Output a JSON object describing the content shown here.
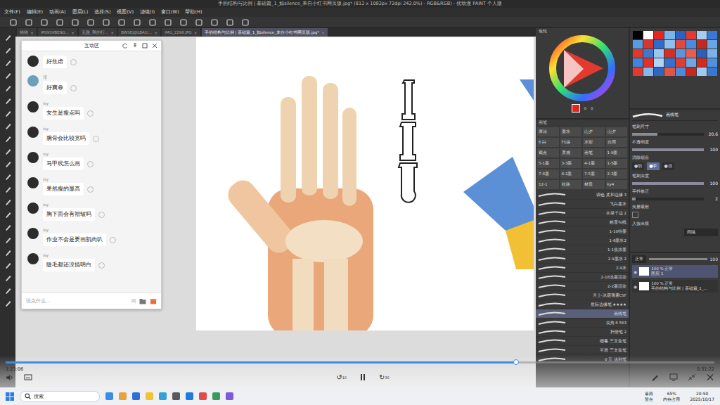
{
  "app": {
    "title": "手的结构与比例 | 基础篇_1_如silence_来自小红书网页版.jpg* (812 x 1082px 72dpi 242.0%) - RGB&RGB) - 优动漫 PAINT 个人版"
  },
  "menu": [
    "文件(F)",
    "编辑(E)",
    "动画(A)",
    "图层(L)",
    "选择(S)",
    "视图(V)",
    "滤镜(I)",
    "窗口(W)",
    "帮助(H)"
  ],
  "doc_tabs": [
    {
      "label": "猫猫",
      "selected": false
    },
    {
      "label": "IP09SVBENG...",
      "selected": false
    },
    {
      "label": "无题_我的行...",
      "selected": false
    },
    {
      "label": "BWSEJ@LBA1I...",
      "selected": false
    },
    {
      "label": "IMG_2298.JPG",
      "selected": false
    },
    {
      "label": "手的结构与比例 | 基础篇_1_如silence_来自小红书网页版.jpg*",
      "selected": true
    }
  ],
  "chat": {
    "title": "互动区",
    "messages": [
      {
        "name": "",
        "text": "好焦虑"
      },
      {
        "name": "淳",
        "text": "好爽😆"
      },
      {
        "name": "ivy",
        "text": "女生是瘦点吗"
      },
      {
        "name": "ivy",
        "text": "腕骨会比较宽吗"
      },
      {
        "name": "ivy",
        "text": "马甲线怎么画"
      },
      {
        "name": "ivy",
        "text": "果然瘦的显高"
      },
      {
        "name": "ivy",
        "text": "胸下面会有褶皱吗"
      },
      {
        "name": "ivy",
        "text": "作业不会是要画肌肉叭"
      },
      {
        "name": "ivy",
        "text": "睫毛都还没搞明白"
      }
    ],
    "input": {
      "placeholder": "说点什么...",
      "hint": "问"
    }
  },
  "color_panel": {
    "title": "色轮",
    "values": [
      "0",
      "0"
    ]
  },
  "swatches": [
    {
      "color": "#000000"
    },
    {
      "color": "#ffffff"
    },
    {
      "color": "#e3261e"
    },
    {
      "color": "#7ab4ea"
    },
    {
      "color": "#2a63c4"
    },
    {
      "color": "#e23a2f"
    },
    {
      "color": "#a7cdf2"
    },
    {
      "color": "#3a77d6"
    },
    {
      "color": "#5b9be0"
    },
    {
      "color": "#d8362c"
    },
    {
      "color": "#2f6cc9"
    },
    {
      "color": "#8fbfee"
    },
    {
      "color": "#e04a3c"
    },
    {
      "color": "#4a8ae0"
    },
    {
      "color": "#c02a22"
    },
    {
      "color": "#6aa6e6"
    },
    {
      "color": "#e4372b"
    },
    {
      "color": "#3c79d3"
    },
    {
      "color": "#9cc6f0"
    },
    {
      "color": "#d42e25"
    },
    {
      "color": "#5895de"
    },
    {
      "color": "#e85d50"
    },
    {
      "color": "#2b5fb8"
    },
    {
      "color": "#7eb1ea"
    },
    {
      "color": "#4383da"
    },
    {
      "color": "#e0312a"
    },
    {
      "color": "#b3d3f4"
    },
    {
      "color": "#3470cc"
    },
    {
      "color": "#dc4034"
    },
    {
      "color": "#6ca6e6"
    },
    {
      "color": "#cf2b23"
    },
    {
      "color": "#5090dd"
    },
    {
      "color": "#e3392d"
    },
    {
      "color": "#86b8ec"
    },
    {
      "color": "#2e67c2"
    },
    {
      "color": "#e25446"
    },
    {
      "color": "#4b8adc"
    },
    {
      "color": "#c9261f"
    },
    {
      "color": "#a0c9f1"
    },
    {
      "color": "#3b76d0"
    }
  ],
  "tool_property": {
    "title": "画线笔",
    "rows": [
      {
        "kind": "slider",
        "label": "笔刷尺寸",
        "value": "20.6",
        "level": 0.35
      },
      {
        "kind": "slider",
        "label": "不透明度",
        "value": "100",
        "level": 1
      },
      {
        "kind": "options",
        "label": "消除锯齿",
        "options": [
          {
            "label": "弱",
            "selected": false
          },
          {
            "label": "中",
            "selected": true
          },
          {
            "label": "强",
            "selected": false
          }
        ]
      },
      {
        "kind": "slider",
        "label": "笔刷浓度",
        "value": "100",
        "level": 1
      },
      {
        "kind": "slider",
        "label": "手抖修正",
        "value": "2",
        "level": 0.05
      },
      {
        "kind": "check",
        "label": "矢量吸附",
        "checked": false
      },
      {
        "kind": "select",
        "label": "入抜出限",
        "value": "间隔"
      }
    ]
  },
  "brush_panel": {
    "title": "画笔",
    "chips": [
      "厚涂",
      "墨水",
      "山夕",
      "山夕",
      "6 白",
      "FS油",
      "水彩",
      "自用",
      "截点",
      "灵感",
      "画笔",
      "1-9墨",
      "5-1墨",
      "3-3墨",
      "4-1墨",
      "1-5墨",
      "7-8墨",
      "8-1墨",
      "7-5墨",
      "2-3墨",
      "12-1",
      "纹路",
      "材质",
      "ky4"
    ],
    "items": [
      {
        "label": "调色 柔和边缘 3",
        "selected": false,
        "stars": 0
      },
      {
        "label": "飞白墨水",
        "selected": false,
        "stars": 0
      },
      {
        "label": "丰厚干边 2",
        "selected": false,
        "stars": 0
      },
      {
        "label": "粗显勾线",
        "selected": false,
        "stars": 0
      },
      {
        "label": "1-10特墨",
        "selected": false,
        "stars": 0
      },
      {
        "label": "1-6墨水2",
        "selected": false,
        "stars": 0
      },
      {
        "label": "1-1焦浓墨",
        "selected": false,
        "stars": 0
      },
      {
        "label": "2-9墨水 2",
        "selected": false,
        "stars": 0
      },
      {
        "label": "2-9水",
        "selected": false,
        "stars": 0
      },
      {
        "label": "2-18淡墨渲染",
        "selected": false,
        "stars": 0
      },
      {
        "label": "2-2墨渲染",
        "selected": false,
        "stars": 0
      },
      {
        "label": "月上-冰霜薄雾CSF",
        "selected": false,
        "stars": 0
      },
      {
        "label": "星际边缘笔",
        "selected": false,
        "stars": 4
      },
      {
        "label": "画线笔",
        "selected": true,
        "stars": 0
      },
      {
        "label": "尖角 6 563",
        "selected": false,
        "stars": 0
      },
      {
        "label": "扫管笔 2",
        "selected": false,
        "stars": 0
      },
      {
        "label": "细毒 三文鱼笔",
        "selected": false,
        "stars": 0
      },
      {
        "label": "平滑 三文鱼笔",
        "selected": false,
        "stars": 0
      },
      {
        "label": "0 五 法则笔",
        "selected": false,
        "stars": 0
      }
    ]
  },
  "layers": {
    "blend": "正常",
    "opacity": "100",
    "items": [
      {
        "info": "100 % 正常",
        "name": "图层 1",
        "selected": true,
        "visible": true
      },
      {
        "info": "100 % 正常",
        "name": "手的结构与比例 | 基础篇_1_...",
        "selected": false,
        "visible": true
      }
    ]
  },
  "video": {
    "current": "1:23:06",
    "total": "0:31:22",
    "level": 0.72,
    "back": "10",
    "forward": "30"
  },
  "taskbar": {
    "search": "搜索",
    "weather": [
      "暴雨",
      "暂在"
    ],
    "memory": [
      "65%",
      "内存占用"
    ],
    "time": "20:50",
    "date": "2025/10/17"
  }
}
